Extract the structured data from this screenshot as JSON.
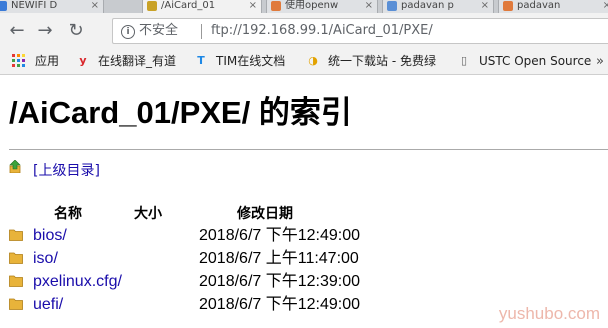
{
  "tabs": [
    {
      "label": "NEWIFI D",
      "favicon_color": "#3b7bd8"
    },
    {
      "label": "/AiCard_01",
      "favicon_color": "#c9a227"
    },
    {
      "label": "使用openw",
      "favicon_color": "#e07a3c"
    },
    {
      "label": "padavan p",
      "favicon_color": "#5a8fd6"
    },
    {
      "label": "padavan",
      "favicon_color": "#e07a3c"
    }
  ],
  "toolbar": {
    "back_icon": "arrow-left-icon",
    "forward_icon": "arrow-right-icon",
    "reload_icon": "reload-icon",
    "security_label": "不安全",
    "url": "ftp://192.168.99.1/AiCard_01/PXE/"
  },
  "bookmarks": [
    {
      "label": "应用",
      "icon": "apps-grid-icon"
    },
    {
      "label": "在线翻译_有道",
      "icon": "youdao-icon",
      "icon_glyph": "y",
      "icon_color": "#d9262b"
    },
    {
      "label": "TIM在线文档",
      "icon": "tim-icon",
      "icon_glyph": "T",
      "icon_color": "#1e88e5"
    },
    {
      "label": "统一下载站 - 免费绿",
      "icon": "download-site-icon",
      "icon_glyph": "◑",
      "icon_color": "#e2a200"
    },
    {
      "label": "USTC Open Source",
      "icon": "page-icon",
      "icon_glyph": "▯",
      "icon_color": "#666666"
    }
  ],
  "page": {
    "title": "/AiCard_01/PXE/ 的索引",
    "parent_link": "[上级目录]",
    "columns": {
      "name": "名称",
      "size": "大小",
      "modified": "修改日期"
    },
    "entries": [
      {
        "name": "bios/",
        "modified": "2018/6/7 下午12:49:00"
      },
      {
        "name": "iso/",
        "modified": "2018/6/7 上午11:47:00"
      },
      {
        "name": "pxelinux.cfg/",
        "modified": "2018/6/7 下午12:39:00"
      },
      {
        "name": "uefi/",
        "modified": "2018/6/7 下午12:49:00"
      }
    ]
  },
  "watermark": "yushubo.com",
  "colors": {
    "link": "#1a0dab",
    "folder": "#e8b33a"
  }
}
